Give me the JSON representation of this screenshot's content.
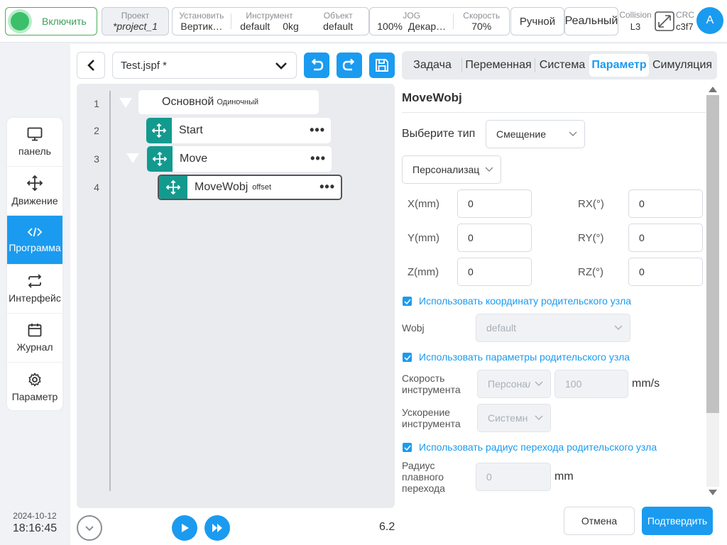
{
  "topbar": {
    "enable_label": "Включить",
    "project_label": "Проект",
    "project_value": "*project_1",
    "install_label": "Установить",
    "install_value": "Вертик…",
    "tool_label": "Инструмент",
    "tool_value": "default",
    "tool_weight": "0kg",
    "object_label": "Объект",
    "object_value": "default",
    "jog_label": "JOG",
    "jog_value": "100%",
    "jog_mode": "Декар…",
    "speed_label": "Скорость",
    "speed_value": "70%",
    "manual_label": "Ручной",
    "real_label": "Реальный",
    "collision_label": "Collision",
    "collision_value": "L3",
    "crc_label": "CRC",
    "crc_value": "c3f7",
    "avatar_letter": "A"
  },
  "sidebar": {
    "items": [
      {
        "label": "панель",
        "icon": "monitor-icon"
      },
      {
        "label": "Движение",
        "icon": "move-icon"
      },
      {
        "label": "Программа",
        "icon": "code-icon"
      },
      {
        "label": "Интерфейс",
        "icon": "swap-icon"
      },
      {
        "label": "Журнал",
        "icon": "calendar-icon"
      },
      {
        "label": "Параметр",
        "icon": "gear-icon"
      }
    ],
    "active": "Программа",
    "date": "2024-10-12",
    "time": "18:16:45"
  },
  "editor": {
    "file_name": "Test.jspf *",
    "tree": [
      {
        "line": "1",
        "label": "Основной",
        "sub": "Одиночный"
      },
      {
        "line": "2",
        "label": "Start",
        "sub": ""
      },
      {
        "line": "3",
        "label": "Move",
        "sub": ""
      },
      {
        "line": "4",
        "label": "MoveWobj",
        "sub": "offset"
      }
    ],
    "version": "6.2"
  },
  "tabs": [
    {
      "label": "Задача"
    },
    {
      "label": "Переменная"
    },
    {
      "label": "Система"
    },
    {
      "label": "Параметр"
    },
    {
      "label": "Симуляция"
    }
  ],
  "active_tab": "Параметр",
  "panel": {
    "title": "MoveWobj",
    "type_label": "Выберите тип",
    "type_value": "Смещение",
    "custom_value": "Персонализац",
    "x_label": "X(mm)",
    "x_value": "0",
    "y_label": "Y(mm)",
    "y_value": "0",
    "z_label": "Z(mm)",
    "z_value": "0",
    "rx_label": "RX(°)",
    "rx_value": "0",
    "ry_label": "RY(°)",
    "ry_value": "0",
    "rz_label": "RZ(°)",
    "rz_value": "0",
    "use_parent_coord": "Использовать координату родительского узла",
    "wobj_label": "Wobj",
    "wobj_value": "default",
    "use_parent_params": "Использовать параметры родительского узла",
    "tool_speed_label_1": "Скорость",
    "tool_speed_label_2": "инструмента",
    "tool_speed_mode": "Персонал",
    "tool_speed_value": "100",
    "tool_speed_unit": "mm/s",
    "tool_accel_label_1": "Ускорение",
    "tool_accel_label_2": "инструмента",
    "tool_accel_mode": "Системн",
    "use_parent_radius": "Использовать радиус перехода родительского узла",
    "radius_label_1": "Радиус",
    "radius_label_2": "плавного",
    "radius_label_3": "перехода",
    "radius_value": "0",
    "radius_unit": "mm"
  },
  "actions": {
    "cancel": "Отмена",
    "confirm": "Подтвердить"
  },
  "colors": {
    "accent": "#1a9bf0",
    "node_icon": "#139a8f",
    "enable_green": "#3cbf6a"
  }
}
